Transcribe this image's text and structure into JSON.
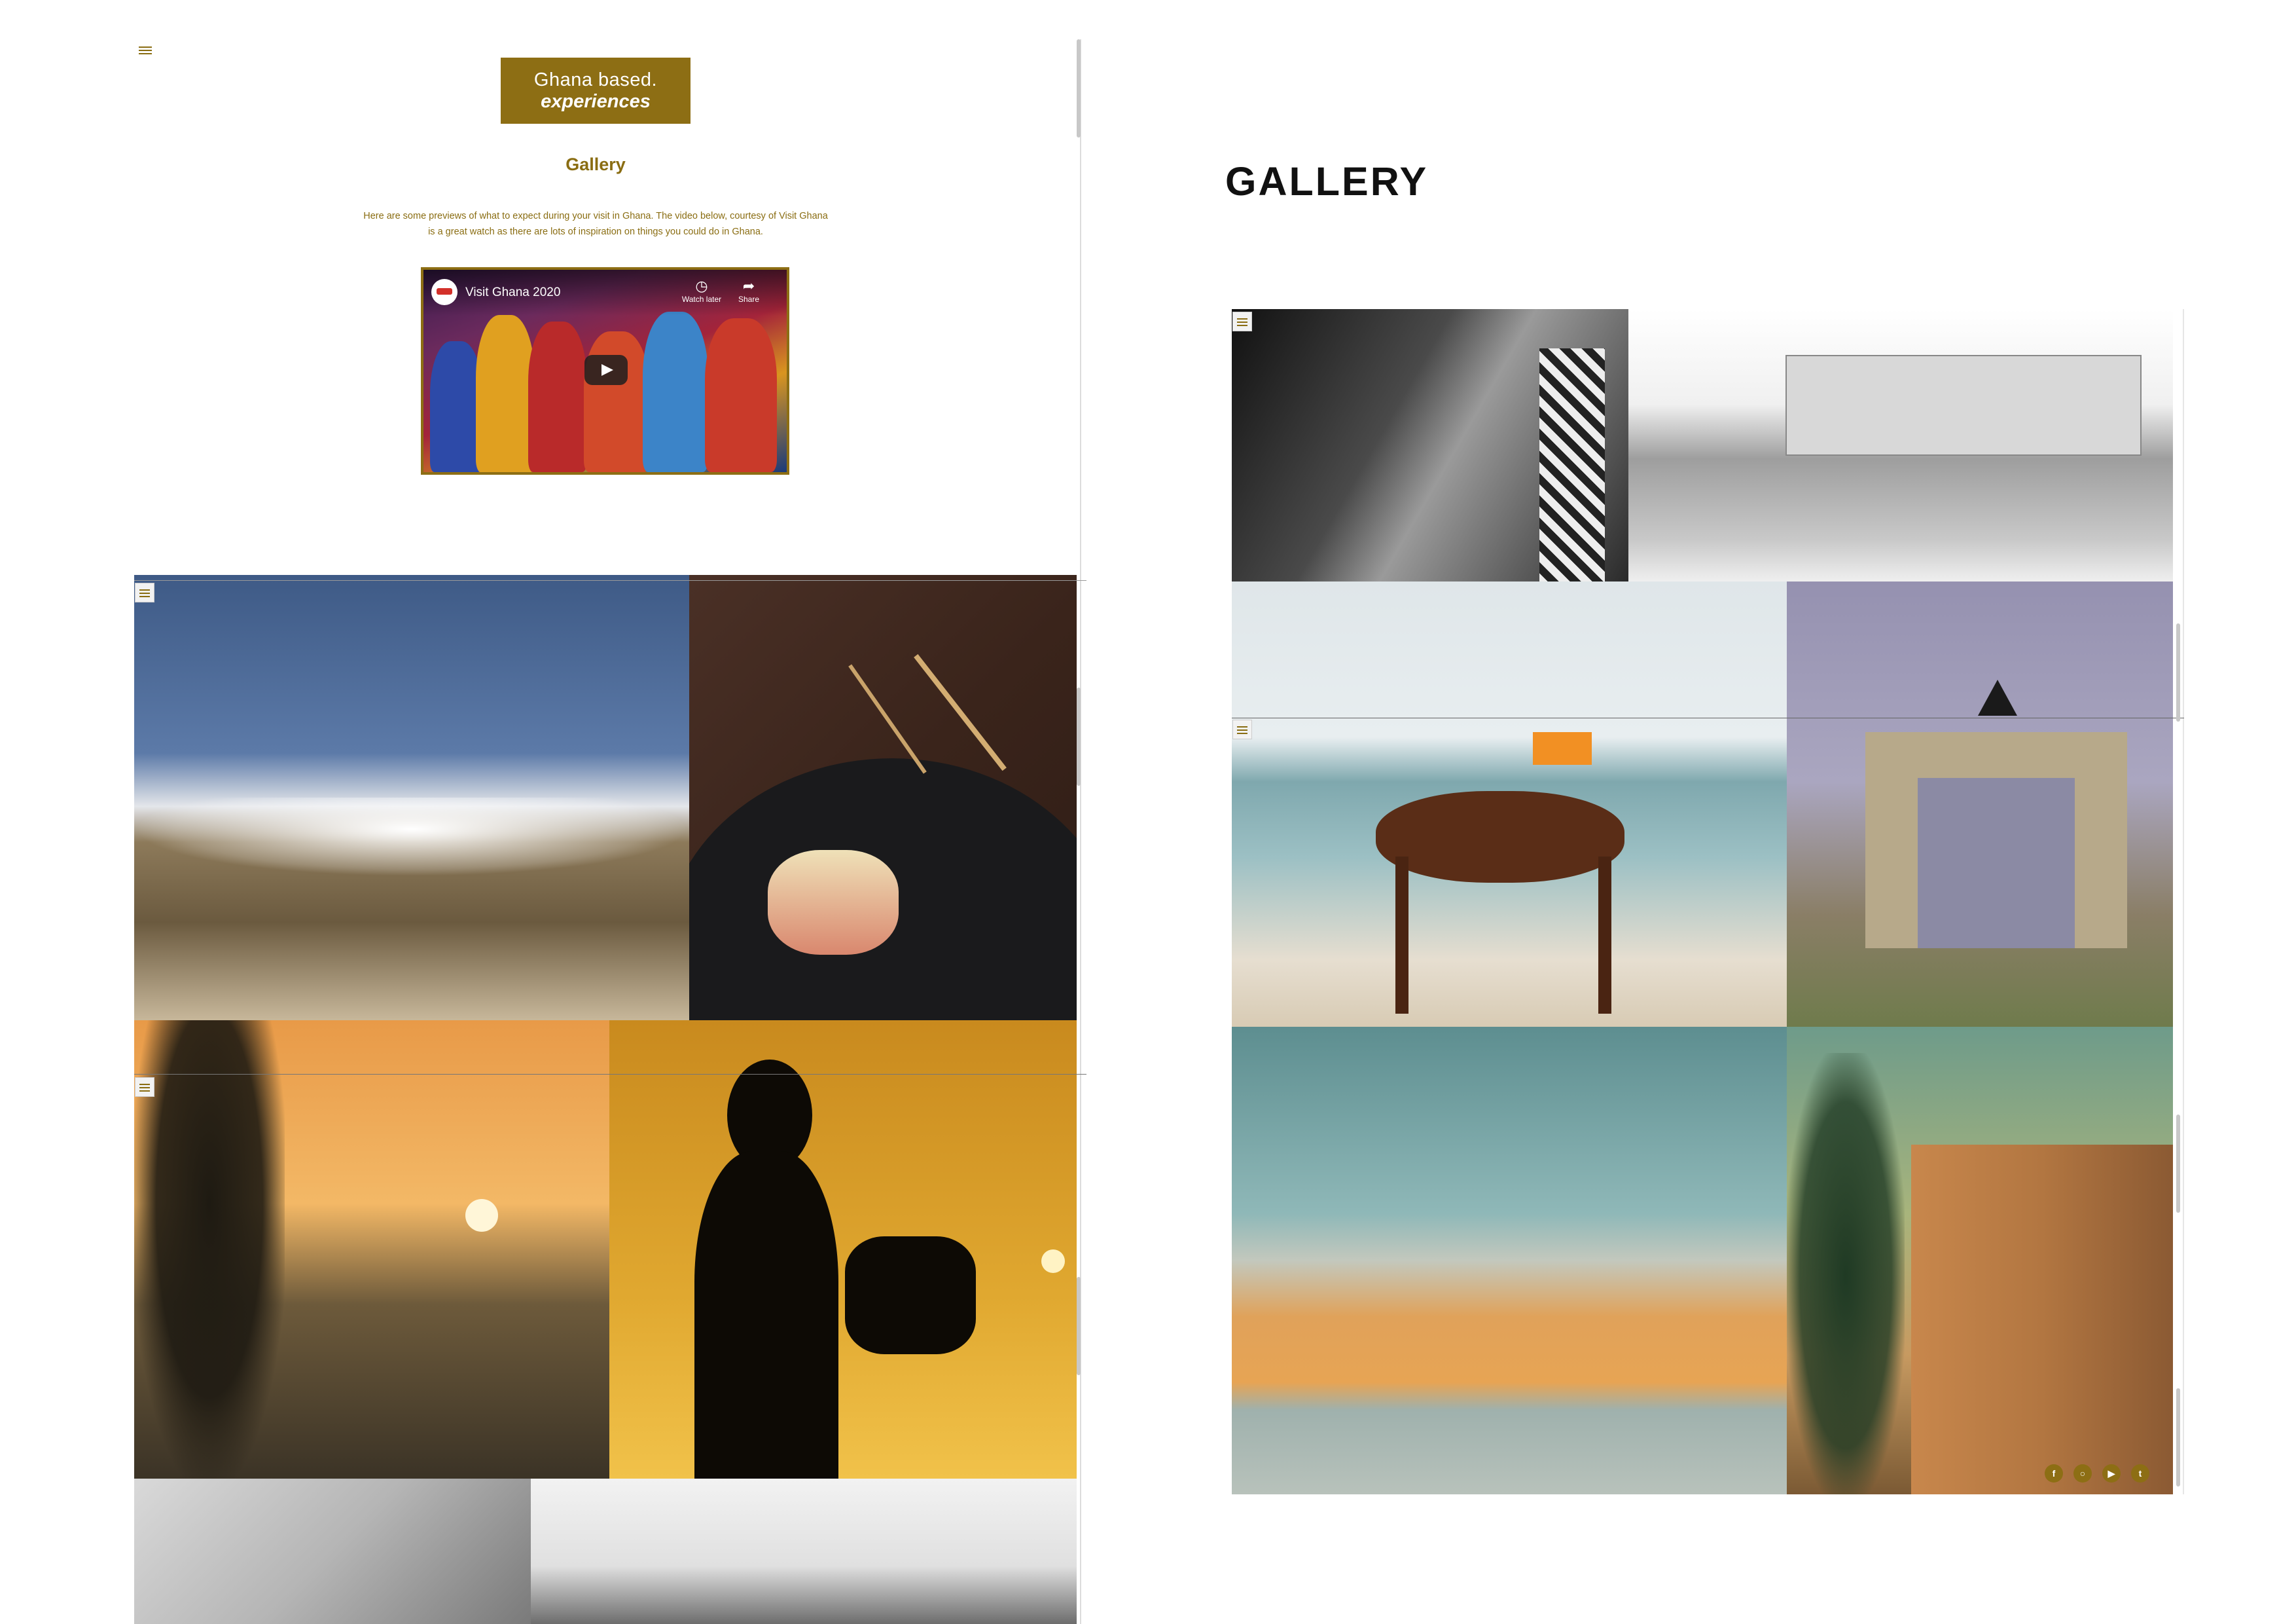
{
  "left_panel": {
    "menu_icon": "hamburger-menu-icon",
    "logo": {
      "line1": "Ghana based.",
      "line2": "experiences"
    },
    "title": "Gallery",
    "intro_line1": "Here are some previews of what to expect during your visit in Ghana. The video below, courtesy of Visit Ghana",
    "intro_line2": "is a great watch as there are lots of inspiration on things you could do in Ghana.",
    "video": {
      "title": "Visit Ghana 2020",
      "watch_later": "Watch later",
      "share": "Share"
    }
  },
  "right_panel": {
    "title": "GALLERY",
    "social_icons": [
      "facebook-icon",
      "instagram-icon",
      "youtube-icon",
      "twitter-icon"
    ]
  },
  "colors": {
    "brand_gold": "#8d6e14",
    "text_gold": "#8a6d12",
    "background": "#ffffff"
  }
}
